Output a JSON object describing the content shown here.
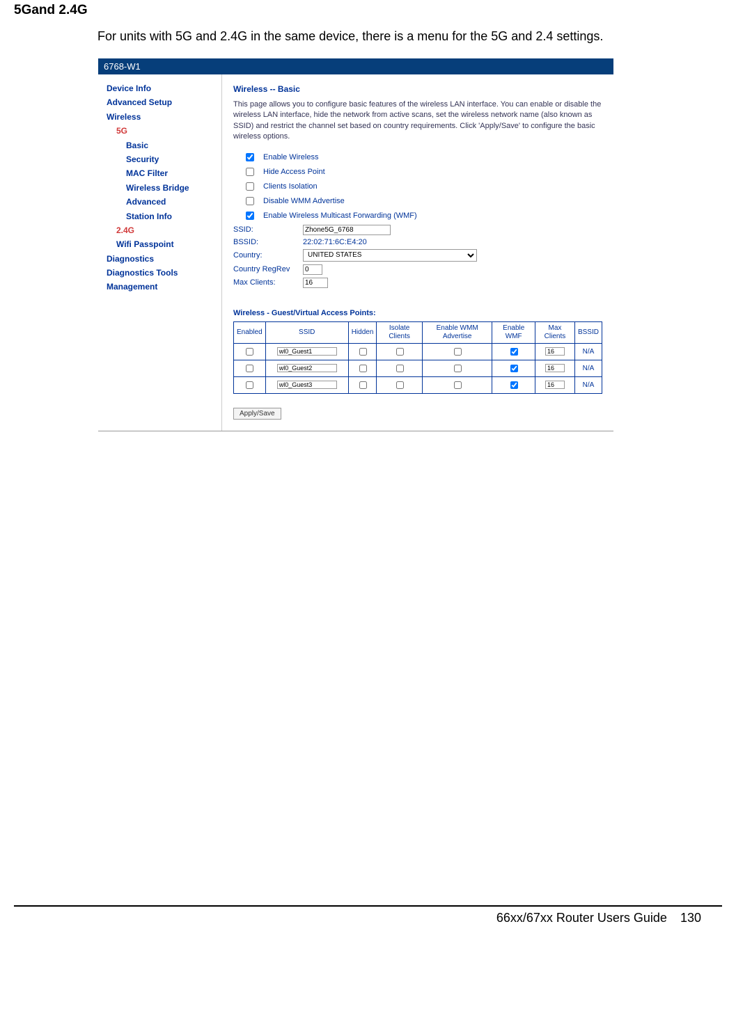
{
  "doc": {
    "section_heading": "5Gand 2.4G",
    "intro": "For units with 5G and 2.4G in the same device, there is a menu for the 5G and 2.4 settings.",
    "footer_text": "66xx/67xx Router Users Guide",
    "footer_page": "130"
  },
  "router": {
    "title_bar": "6768-W1",
    "nav": {
      "device_info": "Device Info",
      "advanced_setup": "Advanced Setup",
      "wireless": "Wireless",
      "g5": "5G",
      "basic": "Basic",
      "security": "Security",
      "mac_filter": "MAC Filter",
      "wireless_bridge": "Wireless Bridge",
      "advanced": "Advanced",
      "station_info": "Station Info",
      "g24": "2.4G",
      "wifi_passpoint": "Wifi Passpoint",
      "diagnostics": "Diagnostics",
      "diagnostics_tools": "Diagnostics Tools",
      "management": "Management"
    },
    "content": {
      "title": "Wireless -- Basic",
      "desc": "This page allows you to configure basic features of the wireless LAN interface. You can enable or disable the wireless LAN interface, hide the network from active scans, set the wireless network name (also known as SSID) and restrict the channel set based on country requirements. Click 'Apply/Save' to configure the basic wireless options.",
      "cb_enable_wireless": "Enable Wireless",
      "cb_hide_ap": "Hide Access Point",
      "cb_clients_isolation": "Clients Isolation",
      "cb_disable_wmm": "Disable WMM Advertise",
      "cb_enable_wmf": "Enable Wireless Multicast Forwarding (WMF)",
      "ssid_label": "SSID:",
      "ssid_value": "Zhone5G_6768",
      "bssid_label": "BSSID:",
      "bssid_value": "22:02:71:6C:E4:20",
      "country_label": "Country:",
      "country_value": "UNITED STATES",
      "country_regrev_label": "Country RegRev",
      "country_regrev_value": "0",
      "max_clients_label": "Max Clients:",
      "max_clients_value": "16",
      "vap_title": "Wireless - Guest/Virtual Access Points:",
      "table_headers": {
        "enabled": "Enabled",
        "ssid": "SSID",
        "hidden": "Hidden",
        "isolate": "Isolate Clients",
        "wmm_adv": "Enable WMM Advertise",
        "wmf": "Enable WMF",
        "max_clients": "Max Clients",
        "bssid": "BSSID"
      },
      "rows": [
        {
          "ssid": "wl0_Guest1",
          "max": "16",
          "bssid": "N/A"
        },
        {
          "ssid": "wl0_Guest2",
          "max": "16",
          "bssid": "N/A"
        },
        {
          "ssid": "wl0_Guest3",
          "max": "16",
          "bssid": "N/A"
        }
      ],
      "apply_save": "Apply/Save"
    }
  }
}
